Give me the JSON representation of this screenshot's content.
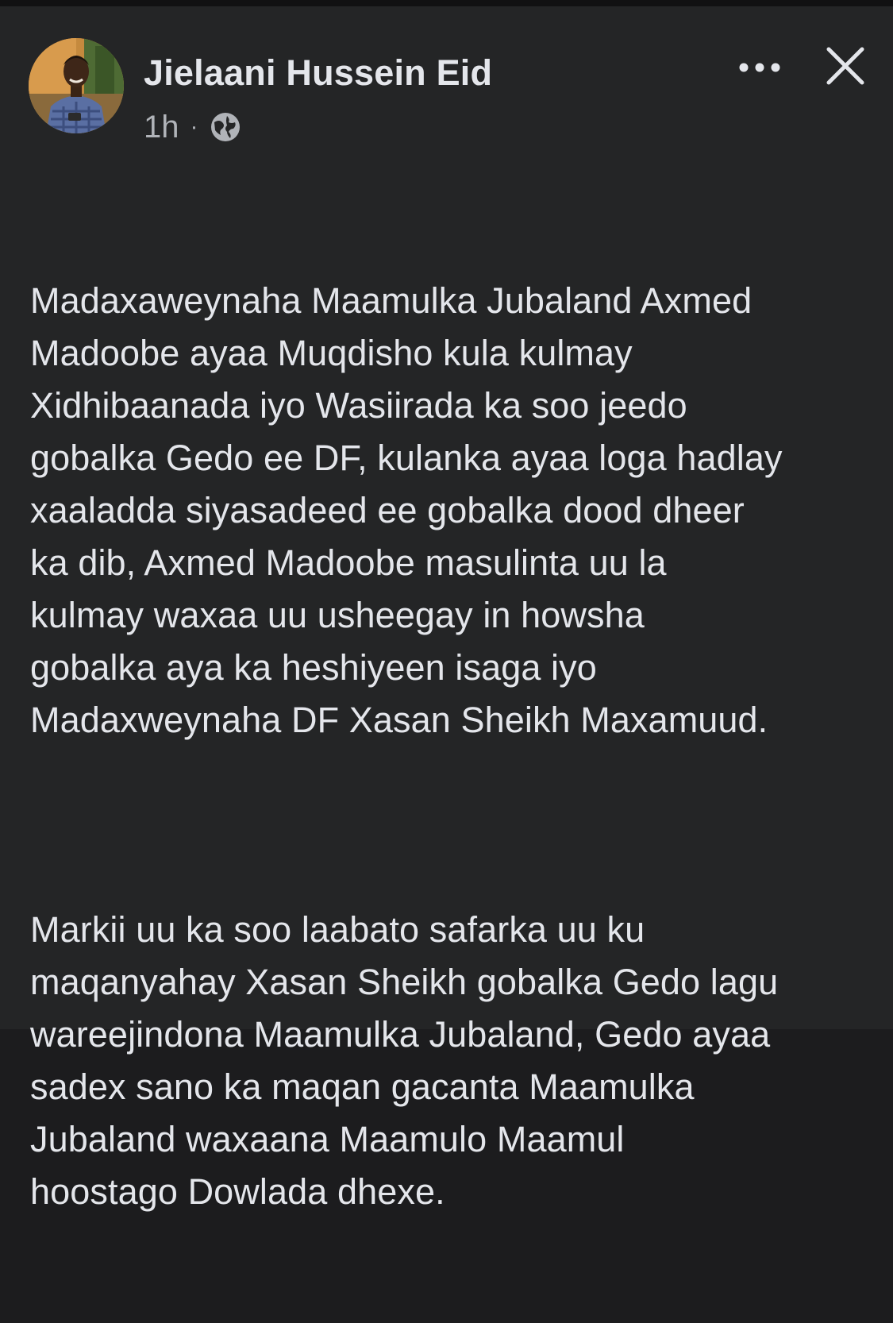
{
  "post": {
    "author_name": "Jielaani Hussein Eid",
    "timestamp": "1h",
    "separator": "·",
    "privacy_icon": "globe-icon",
    "more_icon": "more-horizontal-icon",
    "close_icon": "close-icon",
    "paragraphs": [
      "Madaxaweynaha Maamulka Jubaland Axmed\nMadoobe ayaa Muqdisho kula kulmay\nXidhibaanada iyo Wasiirada ka soo jeedo\ngobalka Gedo ee DF, kulanka ayaa loga hadlay\nxaaladda siyasadeed ee gobalka dood dheer\nka dib, Axmed Madoobe masulinta uu la\nkulmay waxaa uu usheegay in howsha\ngobalka aya ka heshiyeen isaga iyo\nMadaxweynaha DF Xasan Sheikh Maxamuud.",
      "Markii uu ka soo laabato safarka uu ku\nmaqanyahay Xasan Sheikh gobalka Gedo lagu\nwareejindona Maamulka Jubaland, Gedo ayaa\nsadex sano ka maqan gacanta Maamulka\nJubaland waxaana Maamulo Maamul\nhoostago Dowlada dhexe."
    ]
  },
  "colors": {
    "background": "#242526",
    "text_primary": "#e4e6eb",
    "text_secondary": "#b0b3b8"
  }
}
